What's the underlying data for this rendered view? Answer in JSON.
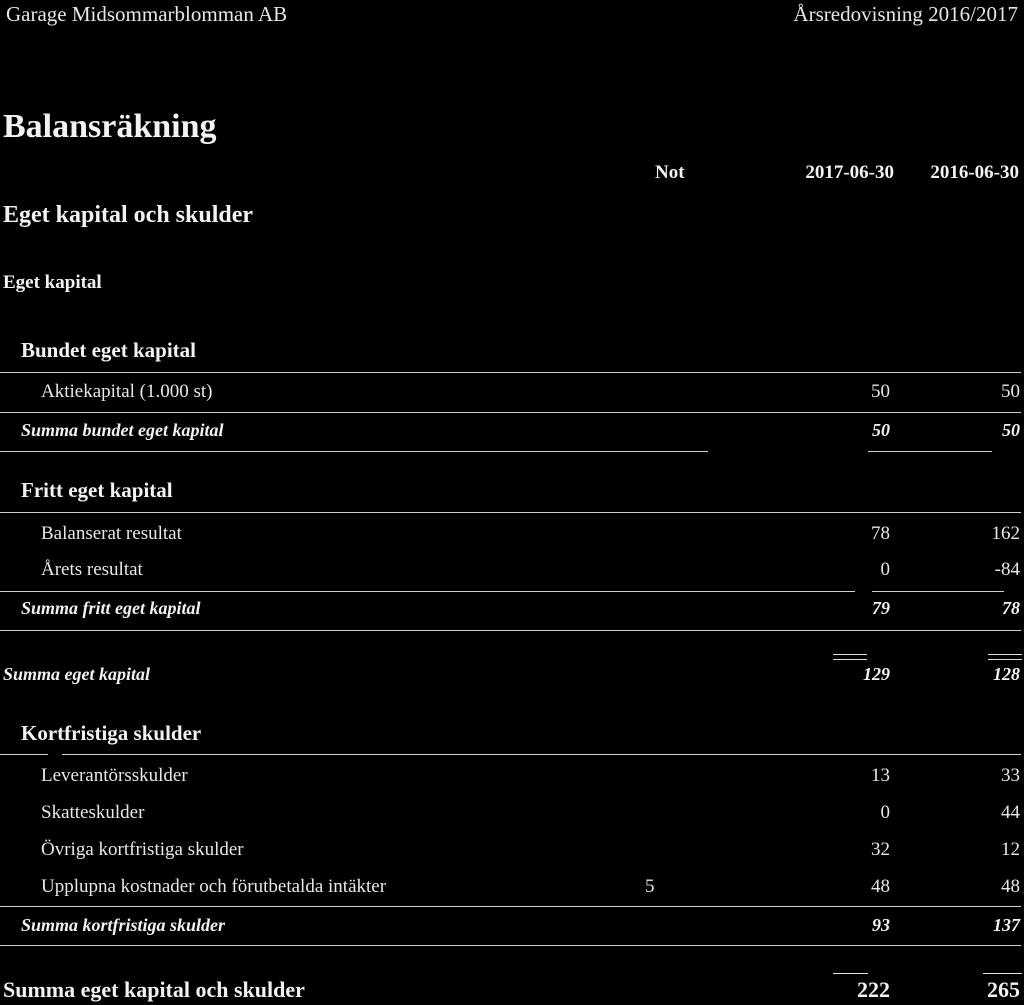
{
  "header": {
    "company": "Garage Midsommarblomman AB",
    "report": "Årsredovisning 2016/2017"
  },
  "title": "Balansräkning",
  "columns": {
    "note": "Not",
    "current": "2017-06-30",
    "previous": "2016-06-30"
  },
  "section_title": "Eget kapital och skulder",
  "subsection_title": "Eget kapital",
  "groups": {
    "bundet": {
      "heading": "Bundet eget kapital",
      "items": [
        {
          "label": "Aktiekapital (1.000 st)",
          "note": "",
          "current": "50",
          "previous": "50"
        }
      ],
      "sum": {
        "label": "Summa bundet eget kapital",
        "current": "50",
        "previous": "50"
      }
    },
    "fritt": {
      "heading": "Fritt eget kapital",
      "items": [
        {
          "label": "Balanserat resultat",
          "note": "",
          "current": "78",
          "previous": "162"
        },
        {
          "label": "Årets resultat",
          "note": "",
          "current": "0",
          "previous": "-84"
        }
      ],
      "sum": {
        "label": "Summa fritt eget kapital",
        "current": "79",
        "previous": "78"
      }
    },
    "eget_kapital_sum": {
      "label": "Summa eget kapital",
      "current": "129",
      "previous": "128"
    },
    "kortfristiga": {
      "heading": "Kortfristiga skulder",
      "items": [
        {
          "label": "Leverantörsskulder",
          "note": "",
          "current": "13",
          "previous": "33"
        },
        {
          "label": "Skatteskulder",
          "note": "",
          "current": "0",
          "previous": "44"
        },
        {
          "label": "Övriga kortfristiga skulder",
          "note": "",
          "current": "32",
          "previous": "12"
        },
        {
          "label": "Upplupna kostnader och förutbetalda intäkter",
          "note": "5",
          "current": "48",
          "previous": "48"
        }
      ],
      "sum": {
        "label": "Summa kortfristiga skulder",
        "current": "93",
        "previous": "137"
      }
    }
  },
  "grand_total": {
    "label": "Summa eget kapital och skulder",
    "current": "222",
    "previous": "265"
  }
}
